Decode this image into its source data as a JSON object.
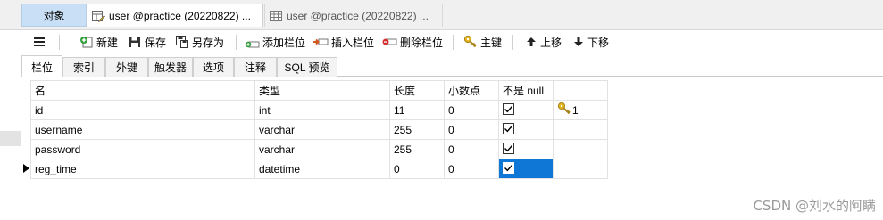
{
  "doc_tabs": {
    "objects": "对象",
    "tab1": "user @practice (20220822) ...",
    "tab2": "user @practice (20220822) ..."
  },
  "toolbar": {
    "new": "新建",
    "save": "保存",
    "save_as": "另存为",
    "add_field": "添加栏位",
    "insert_field": "插入栏位",
    "delete_field": "删除栏位",
    "primary_key": "主键",
    "move_up": "上移",
    "move_down": "下移"
  },
  "sub_tabs": [
    "栏位",
    "索引",
    "外键",
    "触发器",
    "选项",
    "注释",
    "SQL 预览"
  ],
  "grid": {
    "headers": {
      "name": "名",
      "type": "类型",
      "length": "长度",
      "decimals": "小数点",
      "not_null": "不是 null",
      "key": ""
    },
    "rows": [
      {
        "name": "id",
        "type": "int",
        "length": "11",
        "decimals": "0",
        "not_null": true,
        "key": "1"
      },
      {
        "name": "username",
        "type": "varchar",
        "length": "255",
        "decimals": "0",
        "not_null": true,
        "key": ""
      },
      {
        "name": "password",
        "type": "varchar",
        "length": "255",
        "decimals": "0",
        "not_null": true,
        "key": ""
      },
      {
        "name": "reg_time",
        "type": "datetime",
        "length": "0",
        "decimals": "0",
        "not_null": true,
        "key": ""
      }
    ]
  },
  "watermark": "CSDN @刘水的阿瞒",
  "colors": {
    "selected_cell": "#0f78d7",
    "objects_tab": "#c9dff5",
    "key_icon": "#e2b51c"
  }
}
